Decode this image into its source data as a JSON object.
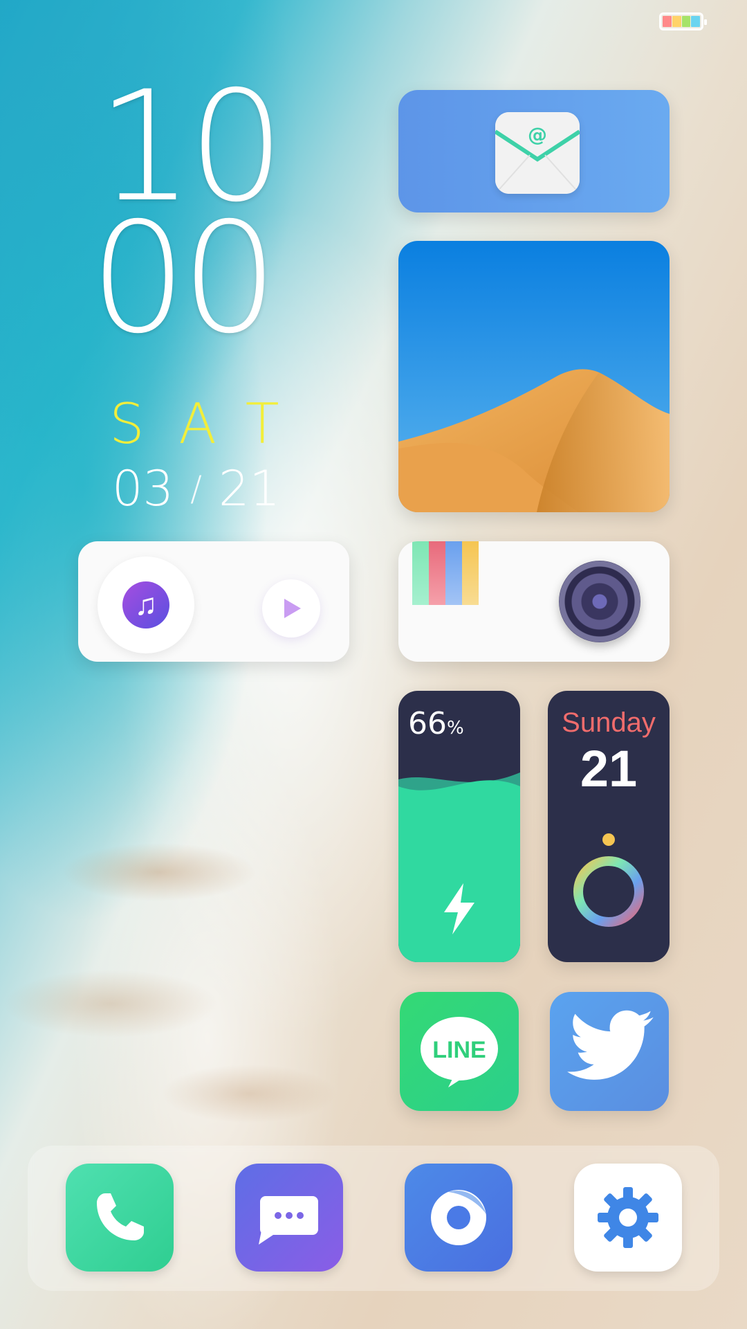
{
  "status_bar": {
    "battery_colors": [
      "#ff8a8a",
      "#ffd36a",
      "#a6e36a",
      "#6ad4f0"
    ]
  },
  "clock": {
    "hour": "10",
    "minute": "00",
    "day": "SAT",
    "month": "03",
    "separator": "/",
    "date": "21"
  },
  "widgets": {
    "mail": {
      "icon": "mail-icon",
      "symbol": "@"
    },
    "photo": {
      "icon": "desert-photo"
    },
    "music": {
      "icons": [
        "music-note-icon",
        "play-icon"
      ]
    },
    "camera": {
      "icons": [
        "color-palette-icon",
        "camera-lens-icon"
      ],
      "palette": [
        "#7ee6b4",
        "#e86a7b",
        "#6aa0ee",
        "#f5c552"
      ]
    },
    "battery": {
      "percent": "66",
      "unit": "%",
      "level": 0.66,
      "icon": "lightning-bolt-icon"
    },
    "calendar": {
      "weekday": "Sunday",
      "day": "21",
      "icon": "ring-progress-icon"
    }
  },
  "apps": {
    "line": {
      "label": "LINE"
    },
    "twitter": {
      "icon": "twitter-bird-icon"
    }
  },
  "dock": {
    "icons": [
      "phone-icon",
      "messages-icon",
      "browser-icon",
      "settings-gear-icon"
    ]
  },
  "colors": {
    "accent_yellow": "#f2ee3a",
    "widget_dark": "#2c2f4a",
    "battery_green": "#30d9a0",
    "calendar_red": "#f06c6c"
  }
}
